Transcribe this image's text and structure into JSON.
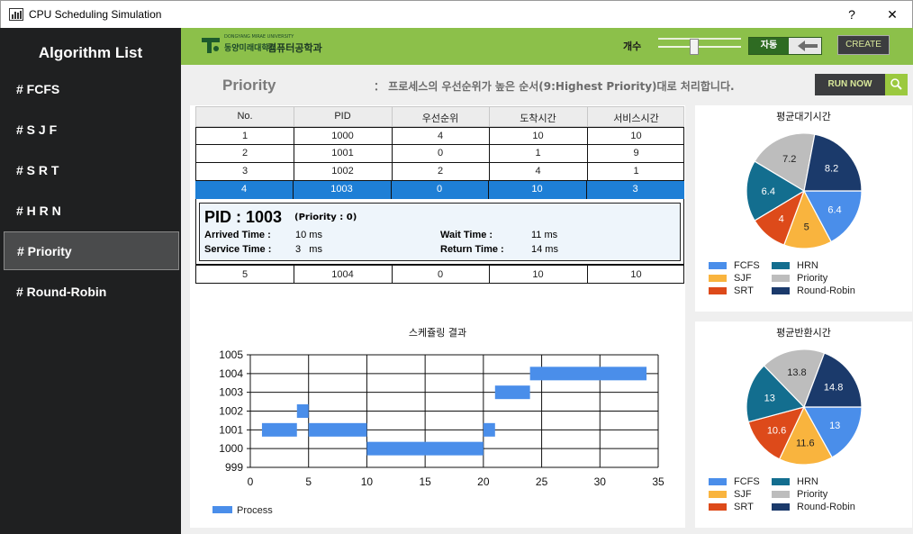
{
  "window": {
    "title": "CPU Scheduling Simulation",
    "help": "?",
    "close": "✕"
  },
  "sidebar": {
    "heading": "Algorithm List",
    "items": [
      {
        "label": "# FCFS"
      },
      {
        "label": "# S J F"
      },
      {
        "label": "# S R T"
      },
      {
        "label": "# H R N"
      },
      {
        "label": "# Priority",
        "active": true
      },
      {
        "label": "# Round-Robin"
      }
    ]
  },
  "topbar": {
    "logo_sub": "DONGYANG MIRAE UNIVERSITY",
    "university": "동양미래대학교",
    "department": "컴퓨터공학과",
    "count_label": "개수",
    "slider_value": 0.4,
    "toggle_label": "자동",
    "create_label": "CREATE"
  },
  "page": {
    "title": "Priority",
    "description": "： 프로세스의 우선순위가 높은 순서(9:Highest Priority)대로 처리합니다.",
    "run_label": "RUN NOW"
  },
  "process_table": {
    "headers": [
      "No.",
      "PID",
      "우선순위",
      "도착시간",
      "서비스시간"
    ],
    "rows": [
      [
        "1",
        "1000",
        "4",
        "10",
        "10"
      ],
      [
        "2",
        "1001",
        "0",
        "1",
        "9"
      ],
      [
        "3",
        "1002",
        "2",
        "4",
        "1"
      ],
      [
        "4",
        "1003",
        "0",
        "10",
        "3"
      ],
      [
        "5",
        "1004",
        "0",
        "10",
        "10"
      ]
    ],
    "selected_row": 3
  },
  "detail": {
    "pid_label": "PID : 1003",
    "priority_label": "(Priority :  0)",
    "arrived_label": "Arrived Time :",
    "arrived_value": "10 ms",
    "service_label": "Service Time :",
    "service_value": "3   ms",
    "wait_label": "Wait Time :",
    "wait_value": "11 ms",
    "return_label": "Return Time :",
    "return_value": "14 ms"
  },
  "colors": {
    "FCFS": "#4a8eea",
    "SJF": "#f9b43e",
    "SRT": "#dd4a1a",
    "HRN": "#136e8f",
    "Priority": "#bdbdbd",
    "Round-Robin": "#1b3a6b"
  },
  "chart_data": [
    {
      "type": "pie",
      "title": "평균대기시간",
      "series": [
        {
          "name": "FCFS",
          "value": 6.4
        },
        {
          "name": "SJF",
          "value": 5
        },
        {
          "name": "SRT",
          "value": 4
        },
        {
          "name": "HRN",
          "value": 6.4
        },
        {
          "name": "Priority",
          "value": 7.2
        },
        {
          "name": "Round-Robin",
          "value": 8.2
        }
      ],
      "legend": [
        "FCFS",
        "HRN",
        "SJF",
        "Priority",
        "SRT",
        "Round-Robin"
      ]
    },
    {
      "type": "pie",
      "title": "평균반환시간",
      "series": [
        {
          "name": "FCFS",
          "value": 13
        },
        {
          "name": "SJF",
          "value": 11.6
        },
        {
          "name": "SRT",
          "value": 10.6
        },
        {
          "name": "HRN",
          "value": 13
        },
        {
          "name": "Priority",
          "value": 13.8
        },
        {
          "name": "Round-Robin",
          "value": 14.8
        }
      ],
      "legend": [
        "FCFS",
        "HRN",
        "SJF",
        "Priority",
        "SRT",
        "Round-Robin"
      ]
    },
    {
      "type": "bar",
      "title": "스케쥴링 결과",
      "xlim": [
        0,
        35
      ],
      "ylim": [
        999,
        1005
      ],
      "xticks": [
        0,
        5,
        10,
        15,
        20,
        25,
        30,
        35
      ],
      "yticks": [
        999,
        1000,
        1001,
        1002,
        1003,
        1004,
        1005
      ],
      "legend": [
        "Process"
      ],
      "segments": [
        {
          "pid": 1001,
          "start": 1,
          "end": 4
        },
        {
          "pid": 1002,
          "start": 4,
          "end": 5
        },
        {
          "pid": 1001,
          "start": 5,
          "end": 10
        },
        {
          "pid": 1000,
          "start": 10,
          "end": 20
        },
        {
          "pid": 1001,
          "start": 20,
          "end": 21
        },
        {
          "pid": 1003,
          "start": 21,
          "end": 24
        },
        {
          "pid": 1004,
          "start": 24,
          "end": 34
        }
      ]
    }
  ]
}
